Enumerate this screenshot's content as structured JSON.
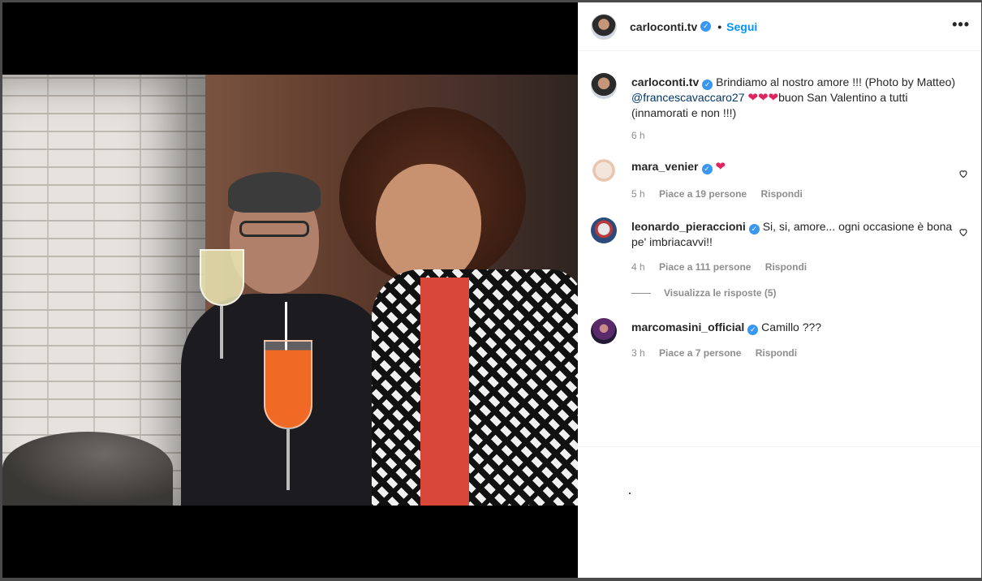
{
  "post": {
    "author": "carloconti.tv",
    "follow_label": "Segui",
    "separator": "•",
    "more_label": "•••",
    "caption_user": "carloconti.tv",
    "caption_text": "Brindiamo al nostro amore !!! (Photo by Matteo)",
    "caption_mention": "@francescavaccaro27",
    "caption_hearts": "❤❤❤",
    "caption_tail": "buon San Valentino a tutti (innamorati e non !!!)",
    "time": "6 h"
  },
  "comments": [
    {
      "user": "mara_venier",
      "text": "",
      "heart": "❤",
      "time": "5 h",
      "likes": "Piace a 19 persone",
      "reply": "Rispondi"
    },
    {
      "user": "leonardo_pieraccioni",
      "text": "Si, si, amore... ogni occasione è bona pe' imbriacavvi!!",
      "time": "4 h",
      "likes": "Piace a 111 persone",
      "reply": "Rispondi",
      "view_replies": "Visualizza le risposte (5)"
    },
    {
      "user": "marcomasini_official",
      "text": "Camillo ???",
      "time": "3 h",
      "likes": "Piace a 7 persone",
      "reply": "Rispondi"
    }
  ],
  "colors": {
    "link": "#0095f6",
    "verified": "#3897f0",
    "heart": "#e0245e",
    "muted": "#8e8e8e"
  }
}
